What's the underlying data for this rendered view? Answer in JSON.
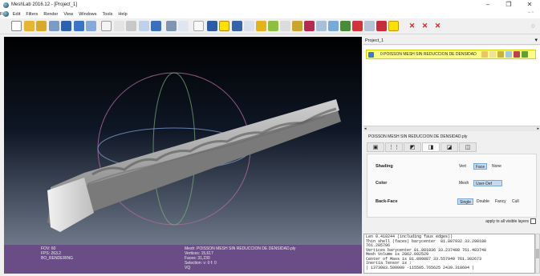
{
  "window": {
    "title": "MeshLab 2016.12 - [Project_1]",
    "controls": [
      "–",
      "❐",
      "✕"
    ]
  },
  "menu": {
    "items": [
      "File",
      "Edit",
      "Filters",
      "Render",
      "View",
      "Windows",
      "Tools",
      "Help"
    ],
    "right_icons": "– ▫"
  },
  "toolbar": {
    "icons": [
      "new-file-icon",
      "open-folder-icon",
      "save-icon",
      "import-icon",
      "export-icon",
      "snapshot-icon",
      "layers-icon",
      "bounding-box-icon",
      "points-icon",
      "wireframe-icon",
      "flat-shading-icon",
      "smooth-shading-icon",
      "light-icon",
      "fancy-light-icon",
      "manipulator-icon",
      "text-annotation-icon",
      "measure-icon",
      "paint-icon",
      "select-icon",
      "align-icon",
      "pick-points-icon",
      "edit-icon",
      "cut-icon",
      "paint-brush-icon",
      "colorize-icon",
      "rgb-icon",
      "zoom-tool-icon",
      "select-faces-icon",
      "select-vertices-icon",
      "info-icon",
      "delete-face-icon",
      "delete-vertex-icon",
      "delete-all-icon"
    ],
    "search_icon": "○"
  },
  "viewport": {
    "info_left": [
      "FOV: 60",
      "FPS: 263.2",
      "BO_RENDERING"
    ],
    "info_right": [
      "Mesh: POISSON MESH SIN REDUCCION DE DENSIDAD.ply",
      "Vertices: 15,617",
      "Faces: 31,230",
      "Selection: v: 0 f: 0",
      "VQ"
    ]
  },
  "layers": {
    "header": "Project_1",
    "header_icon": "▾",
    "layer_name": "0  POISSON MESH SIN REDUCCION DE DENSIDAD",
    "scroll_left": "◂",
    "scroll_right": "▸",
    "mesh_label": "POISSON MESH SIN REDUCCION DE DENSIDAD.ply"
  },
  "render": {
    "tabs": [
      "▣",
      "⋮⋮",
      "◩",
      "◨",
      "◪",
      "◫"
    ],
    "shading_label": "Shading",
    "shading_options": [
      "Vert",
      "Face",
      "None"
    ],
    "shading_selected": "Face",
    "color_label": "Color",
    "color_options": [
      "Mesh",
      "User-Def"
    ],
    "color_selected": "User-Def",
    "backface_label": "Back-Face",
    "backface_options": [
      "Single",
      "Double",
      "Fancy",
      "Cull"
    ],
    "backface_selected": "Single",
    "apply_label": "apply to all visible layers"
  },
  "console": {
    "lines": [
      "Len 0.410244 (including faux edges))",
      "Thin shell (faces) barycenter  81.887932 33.298180",
      "761.285706",
      "Vertices barycenter 81.881836 33.237488 761.483748",
      "Mesh Volume is 2862.092529",
      "Center of Mass is 81.899887 33.557949 761.302673",
      "Inertia Tensor is :",
      "| 1373083.500000 -115505.765625 2439.318604 |"
    ]
  }
}
